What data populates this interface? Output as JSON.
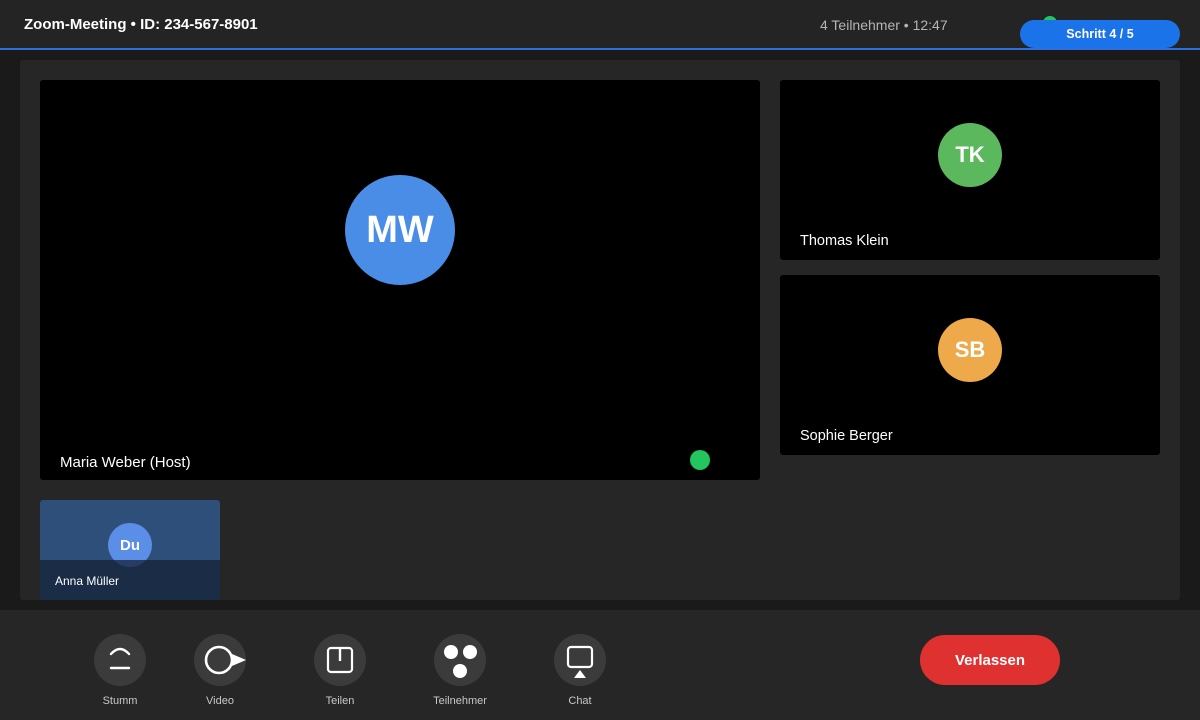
{
  "header": {
    "title": "Zoom-Meeting • ID: 234-567-8901",
    "meeting_info": "4 Teilnehmer • 12:47",
    "step_badge": "Schritt 4 / 5"
  },
  "main_video": {
    "initials": "MW",
    "name": "Maria Weber (Host)",
    "avatar_color": "#4a8de6"
  },
  "side_videos": [
    {
      "initials": "TK",
      "name": "Thomas Klein",
      "avatar_color": "#5bb85d"
    },
    {
      "initials": "SB",
      "name": "Sophie Berger",
      "avatar_color": "#eeaa4a"
    }
  ],
  "self_view": {
    "initials": "Du",
    "name": "Anna Müller"
  },
  "controls": [
    {
      "label": "Stumm",
      "icon": "microphone-muted-icon"
    },
    {
      "label": "Video",
      "icon": "video-camera-icon"
    },
    {
      "label": "Teilen",
      "icon": "share-screen-icon"
    },
    {
      "label": "Teilnehmer",
      "icon": "participants-icon"
    },
    {
      "label": "Chat",
      "icon": "chat-icon"
    }
  ],
  "leave_button": "Verlassen",
  "colors": {
    "accent": "#1a73e8",
    "leave": "#e03131",
    "speaking": "#22c55e"
  }
}
